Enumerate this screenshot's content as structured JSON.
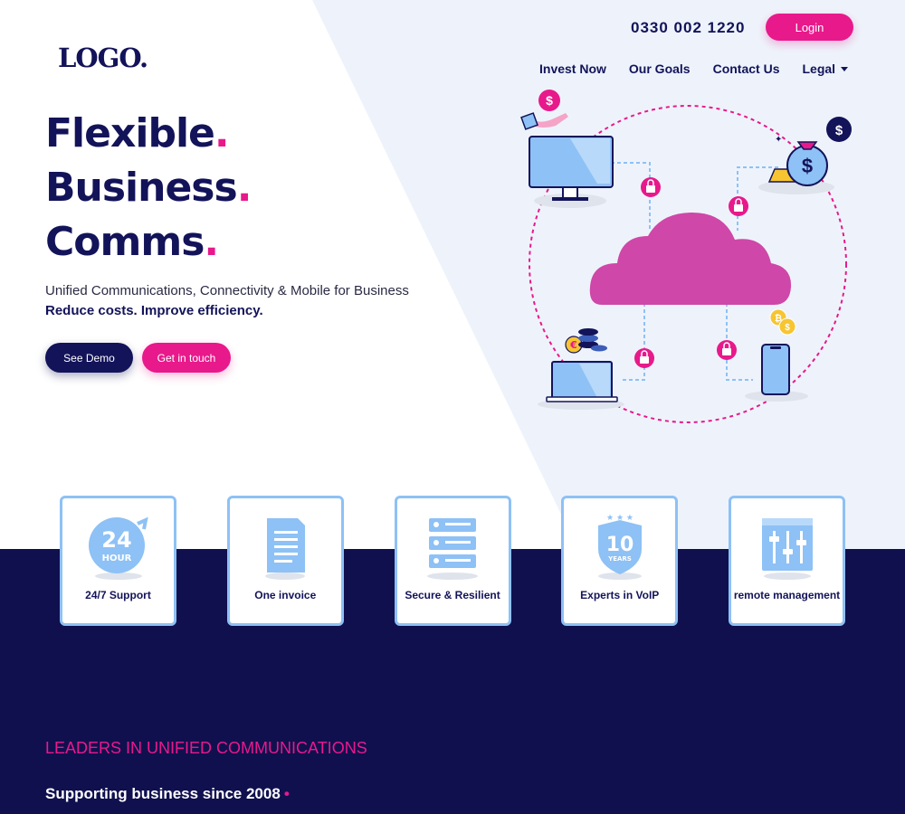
{
  "header": {
    "logo": "LOGO.",
    "phone": "0330 002 1220",
    "login_label": "Login",
    "nav": [
      {
        "label": "Invest Now"
      },
      {
        "label": "Our Goals"
      },
      {
        "label": "Contact Us"
      },
      {
        "label": "Legal",
        "dropdown": true
      }
    ]
  },
  "hero": {
    "lines": [
      {
        "word": "Flexible",
        "dot": "."
      },
      {
        "word": "Business",
        "dot": "."
      },
      {
        "word": "Comms",
        "dot": "."
      }
    ],
    "subtitle": "Unified Communications, Connectivity & Mobile for Business",
    "subtitle_bold": "Reduce costs. Improve efficiency.",
    "demo_label": "See Demo",
    "touch_label": "Get in touch"
  },
  "features": [
    {
      "label": "24/7 Support",
      "icon": "24-hour-icon",
      "icon_top": "24",
      "icon_bottom": "HOUR"
    },
    {
      "label": "One invoice",
      "icon": "invoice-icon"
    },
    {
      "label": "Secure & Resilient",
      "icon": "server-icon"
    },
    {
      "label": "Experts in VoIP",
      "icon": "ten-years-badge-icon",
      "icon_top": "10",
      "icon_bottom": "YEARS"
    },
    {
      "label": "remote management",
      "icon": "control-panel-icon"
    }
  ],
  "section": {
    "kicker": "LEADERS IN UNIFIED COMMUNICATIONS",
    "subtitle": "Supporting business since 2008",
    "dot": "•"
  },
  "illustration": {
    "dollar_symbol": "$",
    "euro_symbol": "€",
    "bitcoin_symbol": "₿"
  },
  "colors": {
    "navy": "#13135a",
    "band": "#10104f",
    "accent": "#e8198b",
    "light_blue": "#8ec1f5",
    "cloud": "#cf47a8"
  }
}
